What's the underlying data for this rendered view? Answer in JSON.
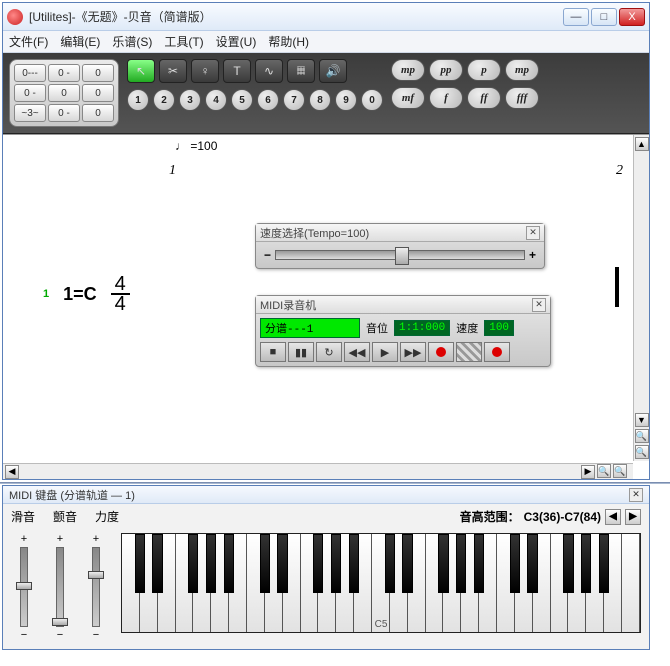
{
  "window": {
    "title": "[Utilites]-《无题》-贝音（简谱版）",
    "minimize": "—",
    "maximize": "□",
    "close": "X"
  },
  "menu": {
    "file": "文件(F)",
    "edit": "编辑(E)",
    "score": "乐谱(S)",
    "tool": "工具(T)",
    "settings": "设置(U)",
    "help": "帮助(H)"
  },
  "note_palette": [
    "0---",
    "0 -",
    "0",
    "0 -",
    "0",
    "0",
    "~3~",
    "0 -",
    "0"
  ],
  "tool_icons": [
    "pointer",
    "cut",
    "person",
    "text",
    "octave",
    "harp",
    "speaker"
  ],
  "numbers": [
    "1",
    "2",
    "3",
    "4",
    "5",
    "6",
    "7",
    "8",
    "9",
    "0"
  ],
  "dynamics_row1": [
    "mp",
    "pp",
    "p",
    "mp"
  ],
  "dynamics_row2": [
    "mf",
    "f",
    "ff",
    "fff"
  ],
  "score": {
    "tempo": "=100",
    "measure_left": "1",
    "measure_right": "2",
    "line_num": "1",
    "key": "1=C",
    "time_num": "4",
    "time_den": "4"
  },
  "tempo_panel": {
    "title": "速度选择(Tempo=100)",
    "minus": "−",
    "plus": "+"
  },
  "recorder": {
    "title": "MIDI录音机",
    "track_label": "分谱---1",
    "pos_label": "音位",
    "pos_value": "1:1:000",
    "speed_label": "速度",
    "speed_value": "100",
    "buttons": [
      "■",
      "▮▮",
      "↻",
      "◀◀",
      "▶",
      "▶▶"
    ]
  },
  "midi_kbd": {
    "title": "MIDI 键盘 (分谱轨道 — 1)",
    "slide": "滑音",
    "tremolo": "颤音",
    "velocity": "力度",
    "range_label": "音高范围：",
    "range_value": "C3(36)-C7(84)",
    "nav_prev": "◀",
    "nav_next": "▶",
    "plus": "+",
    "minus": "−",
    "c5": "C5"
  },
  "scroll": {
    "up": "▲",
    "down": "▼",
    "left": "◀",
    "right": "▶"
  },
  "zoom": {
    "in": "🔍",
    "out": "🔍"
  }
}
